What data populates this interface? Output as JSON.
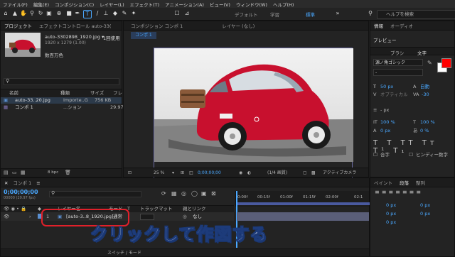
{
  "menu": [
    "ファイル(F)",
    "編集(E)",
    "コンポジション(C)",
    "レイヤー(L)",
    "エフェクト(T)",
    "アニメーション(A)",
    "ビュー(V)",
    "ウィンドウ(W)",
    "ヘルプ(H)"
  ],
  "toolbar": {
    "workspaces": [
      "デフォルト",
      "学習",
      "標準"
    ],
    "active_workspace": "標準",
    "help_search_placeholder": "ヘルプを検索"
  },
  "project_panel": {
    "tabs": [
      "プロジェクト",
      "エフェクトコントロール auto-33("
    ],
    "item_name": "auto-3302898_1920.jpg ▾",
    "item_usage": "1回使用",
    "item_dims": "1920 x 1279 (1.00)",
    "item_color": "数百万色",
    "columns": [
      "名前",
      "種類",
      "サイズ",
      "フレ"
    ],
    "rows": [
      {
        "name": "auto-33..20.jpg",
        "type": "Importe..G",
        "size": "756 KB",
        "frame": ""
      },
      {
        "name": "コンポ 1",
        "type": "...ション",
        "size": "",
        "frame": "29.97"
      }
    ],
    "bpc": "8 bpc"
  },
  "comp_panel": {
    "tab": "コンポジション コンポ 1",
    "layer_tab": "レイヤー (なし)",
    "sub_tab": "コンポ 1",
    "zoom": "25 %",
    "timecode": "0;00;00;00",
    "resolution": "(1/4 画質)",
    "camera": "アクティブカメラ"
  },
  "right_panel": {
    "top_tabs": [
      "情報",
      "オーディオ"
    ],
    "preview": "プレビュー",
    "tabs": [
      "ブラシ",
      "文字"
    ],
    "font": "源ノ角ゴシック",
    "font_style": "-",
    "size": "50 px",
    "leading": "自動",
    "tracking": "-30",
    "kerning": "オプティカル",
    "stroke": "- px",
    "scale_v": "100 %",
    "scale_h": "100 %",
    "baseline": "0 px",
    "tsume": "0 %",
    "checkbox1": "合字",
    "checkbox2": "ヒンディー数字",
    "colors": {
      "fill": "#ff0000",
      "stroke": "#ffffff"
    }
  },
  "paragraph_panel": {
    "tabs": [
      "ペイント",
      "段落",
      "整列"
    ],
    "values": [
      "0 px",
      "0 px",
      "0 px",
      "0 px",
      "0 px"
    ]
  },
  "timeline": {
    "tab": "コンポ 1",
    "timecode": "0;00;00;00",
    "fps": "00000 (29.97 fps)",
    "columns": [
      "レイヤー名",
      "モード",
      "T",
      "トラックマット",
      "親とリンク"
    ],
    "ruler": [
      "0:00f",
      "00:15f",
      "01:00f",
      "01:15f",
      "02:00f",
      "02:1"
    ],
    "layer": {
      "index": "1",
      "name": "[auto-3..8_1920.jpg]",
      "mode": "通常",
      "parent": "なし"
    },
    "bottom": "スイッチ / モード"
  },
  "overlay_text": "クリックして作図する"
}
